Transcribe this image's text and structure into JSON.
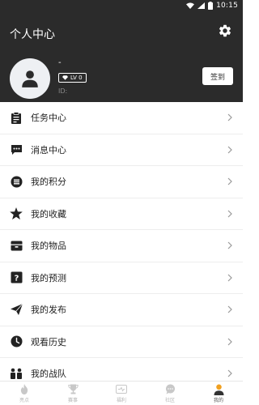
{
  "status_bar": {
    "time": "10:15",
    "icons": [
      "wifi-icon",
      "signal-icon",
      "battery-icon"
    ]
  },
  "header": {
    "title": "个人中心",
    "settings_icon": "gear-icon",
    "background": "#2b2b2b"
  },
  "profile": {
    "nickname": "-",
    "level": "LV 0",
    "id_label": "ID:",
    "checkin_label": "签到",
    "avatar_icon": "user-icon"
  },
  "menu": {
    "items": [
      {
        "label": "任务中心",
        "icon": "clipboard-icon"
      },
      {
        "label": "消息中心",
        "icon": "chat-bubble-icon"
      },
      {
        "label": "我的积分",
        "icon": "coin-icon"
      },
      {
        "label": "我的收藏",
        "icon": "star-icon"
      },
      {
        "label": "我的物品",
        "icon": "box-icon"
      },
      {
        "label": "我的预测",
        "icon": "question-box-icon"
      },
      {
        "label": "我的发布",
        "icon": "paper-plane-icon"
      },
      {
        "label": "观看历史",
        "icon": "clock-icon"
      },
      {
        "label": "我的战队",
        "icon": "team-icon"
      }
    ]
  },
  "tabbar": {
    "tabs": [
      {
        "label": "亮点",
        "icon": "flame-icon",
        "active": false
      },
      {
        "label": "赛事",
        "icon": "trophy-icon",
        "active": false
      },
      {
        "label": "福利",
        "icon": "ticket-icon",
        "active": false
      },
      {
        "label": "社区",
        "icon": "chat-icon",
        "active": false
      },
      {
        "label": "我的",
        "icon": "person-icon",
        "active": true
      }
    ]
  },
  "colors": {
    "header_bg": "#2b2b2b",
    "text": "#222222",
    "tab_inactive": "#b5b5b5",
    "active_tab_accent": "#f0a020"
  }
}
